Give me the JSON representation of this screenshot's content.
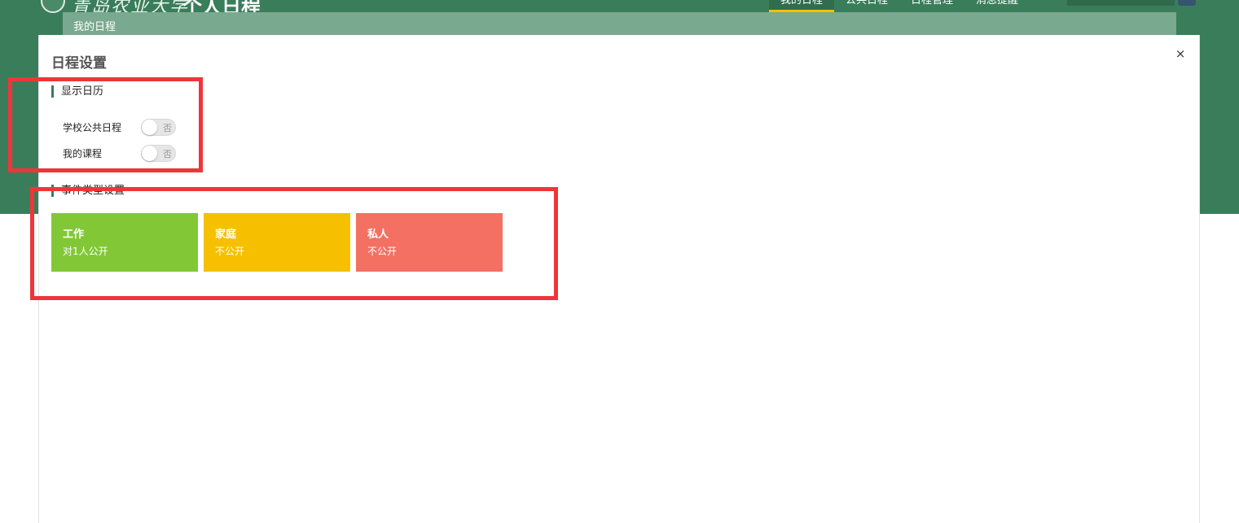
{
  "header": {
    "logo_script": "青岛农业大学",
    "app_title": "个人日程",
    "nav": [
      {
        "label": "我的日程",
        "active": true
      },
      {
        "label": "公共日程",
        "active": false
      },
      {
        "label": "日程管理",
        "active": false
      },
      {
        "label": "消息提醒",
        "active": false
      }
    ]
  },
  "breadcrumb": {
    "text": "我的日程"
  },
  "modal": {
    "title": "日程设置",
    "close_label": "×",
    "display_section": {
      "title": "显示日历",
      "toggles": [
        {
          "label": "学校公共日程",
          "state_text": "否",
          "on": false
        },
        {
          "label": "我的课程",
          "state_text": "否",
          "on": false
        }
      ]
    },
    "event_section": {
      "title": "事件类型设置",
      "types": [
        {
          "name": "工作",
          "desc": "对1人公开",
          "color": "#82c836"
        },
        {
          "name": "家庭",
          "desc": "不公开",
          "color": "#f6c000"
        },
        {
          "name": "私人",
          "desc": "不公开",
          "color": "#f37063"
        }
      ]
    }
  },
  "colors": {
    "header_green": "#3a7d5b",
    "breadcrumb_green": "#79a98f",
    "nav_active_underline": "#f6c000",
    "annotation_red": "#f0353a"
  }
}
